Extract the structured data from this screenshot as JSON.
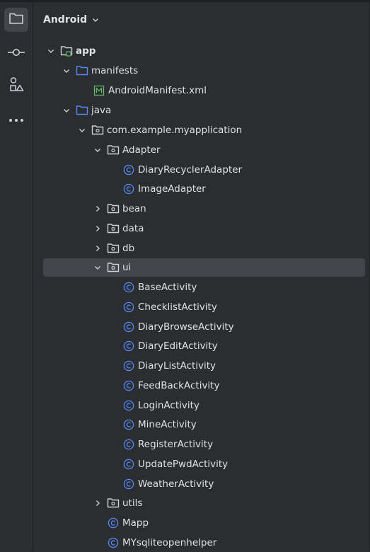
{
  "panel": {
    "title": "Android"
  },
  "toolbar": {
    "items": [
      {
        "icon": "folder-icon"
      },
      {
        "icon": "commit-icon"
      },
      {
        "icon": "shapes-icon"
      },
      {
        "icon": "more-icon"
      }
    ]
  },
  "tree": {
    "rows": [
      {
        "label": "app"
      },
      {
        "label": "manifests"
      },
      {
        "label": "AndroidManifest.xml"
      },
      {
        "label": "java"
      },
      {
        "label": "com.example.myapplication"
      },
      {
        "label": "Adapter"
      },
      {
        "label": "DiaryRecyclerAdapter"
      },
      {
        "label": "ImageAdapter"
      },
      {
        "label": "bean"
      },
      {
        "label": "data"
      },
      {
        "label": "db"
      },
      {
        "label": "ui"
      },
      {
        "label": "BaseActivity"
      },
      {
        "label": "ChecklistActivity"
      },
      {
        "label": "DiaryBrowseActivity"
      },
      {
        "label": "DiaryEditActivity"
      },
      {
        "label": "DiaryListActivity"
      },
      {
        "label": "FeedBackActivity"
      },
      {
        "label": "LoginActivity"
      },
      {
        "label": "MineActivity"
      },
      {
        "label": "RegisterActivity"
      },
      {
        "label": "UpdatePwdActivity"
      },
      {
        "label": "WeatherActivity"
      },
      {
        "label": "utils"
      },
      {
        "label": "Mapp"
      },
      {
        "label": "MYsqliteopenhelper"
      }
    ]
  },
  "colors": {
    "background": "#2b2d30",
    "selection": "#43454a",
    "folder_blue": "#548af7",
    "class_blue": "#548af7",
    "manifest_green": "#5fb865",
    "text": "#dfe1e5"
  }
}
